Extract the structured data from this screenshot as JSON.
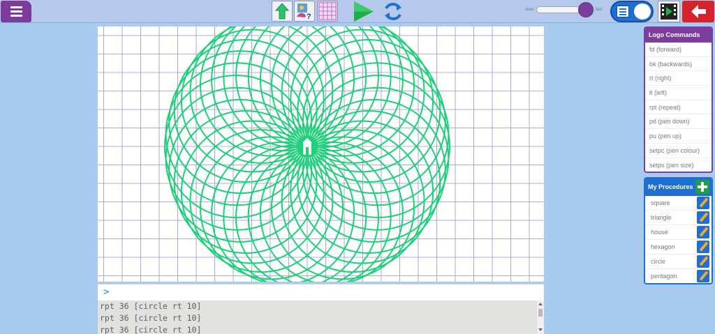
{
  "toolbar": {
    "menu_icon": "hamburger-menu-icon",
    "speed_slow_label": "slow",
    "speed_fast_label": "fast",
    "speed_level_percent": 90,
    "colors": {
      "accent_purple": "#7b3d9e",
      "accent_blue": "#1f6fd1",
      "go_green": "#1fae4a",
      "back_red": "#d6232b",
      "pen_green": "#1fd07a"
    }
  },
  "logo_commands": {
    "title": "Logo Commands",
    "items": [
      "fd (forward)",
      "bk (backwards)",
      "rt (right)",
      "lt (left)",
      "rpt (repeat)",
      "pd (pen down)",
      "pu (pen up)",
      "setpc (pen colour)",
      "setps (pen size)"
    ]
  },
  "procedures": {
    "title": "My Procedures",
    "items": [
      "square",
      "triangle",
      "house",
      "hexagon",
      "circle",
      "pentagon"
    ]
  },
  "console": {
    "prompt": ">",
    "input_value": "",
    "history": [
      "rpt 36 [circle rt 10]",
      "rpt 36 [circle rt 10]",
      "rpt 36 [circle rt 10]"
    ]
  },
  "drawing": {
    "repeat_count": 36,
    "turn_degrees": 10
  }
}
